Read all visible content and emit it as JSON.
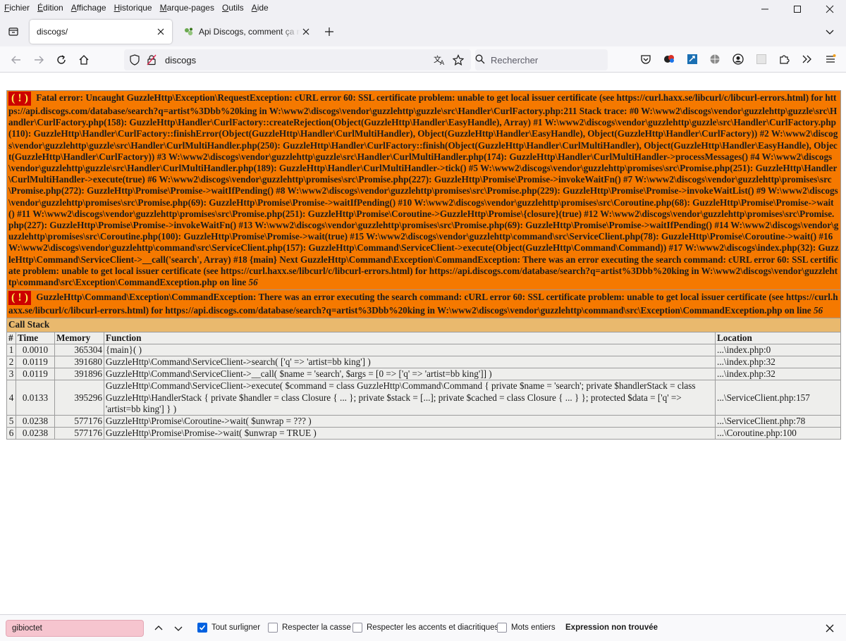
{
  "menubar": {
    "items": [
      {
        "underline": "F",
        "rest": "ichier"
      },
      {
        "underline": "É",
        "rest": "dition"
      },
      {
        "underline": "A",
        "rest": "ffichage"
      },
      {
        "underline": "H",
        "rest": "istorique"
      },
      {
        "underline": "M",
        "rest": "arque-pages"
      },
      {
        "underline": "O",
        "rest": "utils"
      },
      {
        "underline": "A",
        "rest": "ide"
      }
    ]
  },
  "tabs": {
    "active": {
      "title": "discogs/"
    },
    "inactive": {
      "title": "Api Discogs, comment ça marche"
    }
  },
  "navbar": {
    "url": "discogs",
    "search_placeholder": "Rechercher"
  },
  "error1": {
    "badge": "( ! )",
    "text": "Fatal error: Uncaught GuzzleHttp\\Exception\\RequestException: cURL error 60: SSL certificate problem: unable to get local issuer certificate (see https://curl.haxx.se/libcurl/c/libcurl-errors.html) for https://api.discogs.com/database/search?q=artist%3Dbb%20king in W:\\www2\\discogs\\vendor\\guzzlehttp\\guzzle\\src\\Handler\\CurlFactory.php:211 Stack trace: #0 W:\\www2\\discogs\\vendor\\guzzlehttp\\guzzle\\src\\Handler\\CurlFactory.php(158): GuzzleHttp\\Handler\\CurlFactory::createRejection(Object(GuzzleHttp\\Handler\\EasyHandle), Array) #1 W:\\www2\\discogs\\vendor\\guzzlehttp\\guzzle\\src\\Handler\\CurlFactory.php(110): GuzzleHttp\\Handler\\CurlFactory::finishError(Object(GuzzleHttp\\Handler\\CurlMultiHandler), Object(GuzzleHttp\\Handler\\EasyHandle), Object(GuzzleHttp\\Handler\\CurlFactory)) #2 W:\\www2\\discogs\\vendor\\guzzlehttp\\guzzle\\src\\Handler\\CurlMultiHandler.php(250): GuzzleHttp\\Handler\\CurlFactory::finish(Object(GuzzleHttp\\Handler\\CurlMultiHandler), Object(GuzzleHttp\\Handler\\EasyHandle), Object(GuzzleHttp\\Handler\\CurlFactory)) #3 W:\\www2\\discogs\\vendor\\guzzlehttp\\guzzle\\src\\Handler\\CurlMultiHandler.php(174): GuzzleHttp\\Handler\\CurlMultiHandler->processMessages() #4 W:\\www2\\discogs\\vendor\\guzzlehttp\\guzzle\\src\\Handler\\CurlMultiHandler.php(189): GuzzleHttp\\Handler\\CurlMultiHandler->tick() #5 W:\\www2\\discogs\\vendor\\guzzlehttp\\promises\\src\\Promise.php(251): GuzzleHttp\\Handler\\CurlMultiHandler->execute(true) #6 W:\\www2\\discogs\\vendor\\guzzlehttp\\promises\\src\\Promise.php(227): GuzzleHttp\\Promise\\Promise->invokeWaitFn() #7 W:\\www2\\discogs\\vendor\\guzzlehttp\\promises\\src\\Promise.php(272): GuzzleHttp\\Promise\\Promise->waitIfPending() #8 W:\\www2\\discogs\\vendor\\guzzlehttp\\promises\\src\\Promise.php(229): GuzzleHttp\\Promise\\Promise->invokeWaitList() #9 W:\\www2\\discogs\\vendor\\guzzlehttp\\promises\\src\\Promise.php(69): GuzzleHttp\\Promise\\Promise->waitIfPending() #10 W:\\www2\\discogs\\vendor\\guzzlehttp\\promises\\src\\Coroutine.php(68): GuzzleHttp\\Promise\\Promise->wait() #11 W:\\www2\\discogs\\vendor\\guzzlehttp\\promises\\src\\Promise.php(251): GuzzleHttp\\Promise\\Coroutine->GuzzleHttp\\Promise\\{closure}(true) #12 W:\\www2\\discogs\\vendor\\guzzlehttp\\promises\\src\\Promise.php(227): GuzzleHttp\\Promise\\Promise->invokeWaitFn() #13 W:\\www2\\discogs\\vendor\\guzzlehttp\\promises\\src\\Promise.php(69): GuzzleHttp\\Promise\\Promise->waitIfPending() #14 W:\\www2\\discogs\\vendor\\guzzlehttp\\promises\\src\\Coroutine.php(100): GuzzleHttp\\Promise\\Promise->wait(true) #15 W:\\www2\\discogs\\vendor\\guzzlehttp\\command\\src\\ServiceClient.php(78): GuzzleHttp\\Promise\\Coroutine->wait() #16 W:\\www2\\discogs\\vendor\\guzzlehttp\\command\\src\\ServiceClient.php(157): GuzzleHttp\\Command\\ServiceClient->execute(Object(GuzzleHttp\\Command\\Command)) #17 W:\\www2\\discogs\\index.php(32): GuzzleHttp\\Command\\ServiceClient->__call('search', Array) #18 {main} Next GuzzleHttp\\Command\\Exception\\CommandException: There was an error executing the search command: cURL error 60: SSL certificate problem: unable to get local issuer certificate (see https://curl.haxx.se/libcurl/c/libcurl-errors.html) for https://api.discogs.com/database/search?q=artist%3Dbb%20king in W:\\www2\\discogs\\vendor\\guzzlehttp\\command\\src\\Exception\\CommandException.php on line",
    "line": "56"
  },
  "error2": {
    "badge": "( ! )",
    "text": "GuzzleHttp\\Command\\Exception\\CommandException: There was an error executing the search command: cURL error 60: SSL certificate problem: unable to get local issuer certificate (see https://curl.haxx.se/libcurl/c/libcurl-errors.html) for https://api.discogs.com/database/search?q=artist%3Dbb%20king in W:\\www2\\discogs\\vendor\\guzzlehttp\\command\\src\\Exception\\CommandException.php on line",
    "line": "56"
  },
  "callstack": {
    "title": "Call Stack",
    "headers": {
      "num": "#",
      "time": "Time",
      "memory": "Memory",
      "function": "Function",
      "location": "Location"
    },
    "rows": [
      {
        "num": "1",
        "time": "0.0010",
        "memory": "365304",
        "function": "{main}( )",
        "location": "...\\index.php:0"
      },
      {
        "num": "2",
        "time": "0.0119",
        "memory": "391680",
        "function": "GuzzleHttp\\Command\\ServiceClient->search( ['q' => 'artist=bb king'] )",
        "location": "...\\index.php:32"
      },
      {
        "num": "3",
        "time": "0.0119",
        "memory": "391896",
        "function": "GuzzleHttp\\Command\\ServiceClient->__call( $name = 'search', $args = [0 => ['q' => 'artist=bb king']] )",
        "location": "...\\index.php:32"
      },
      {
        "num": "4",
        "time": "0.0133",
        "memory": "395296",
        "function": "GuzzleHttp\\Command\\ServiceClient->execute( $command = class GuzzleHttp\\Command\\Command { private $name = 'search'; private $handlerStack = class GuzzleHttp\\HandlerStack { private $handler = class Closure { ... }; private $stack = [...]; private $cached = class Closure { ... } }; protected $data = ['q' => 'artist=bb king'] } )",
        "location": "...\\ServiceClient.php:157"
      },
      {
        "num": "5",
        "time": "0.0238",
        "memory": "577176",
        "function": "GuzzleHttp\\Promise\\Coroutine->wait( $unwrap = ??? )",
        "location": "...\\ServiceClient.php:78"
      },
      {
        "num": "6",
        "time": "0.0238",
        "memory": "577176",
        "function": "GuzzleHttp\\Promise\\Promise->wait( $unwrap = TRUE )",
        "location": "...\\Coroutine.php:100"
      }
    ]
  },
  "findbar": {
    "value": "gibioctet",
    "opt_highlight": "Tout surligner",
    "opt_case": "Respecter la casse",
    "opt_accents": "Respecter les accents et diacritiques",
    "opt_words": "Mots entiers",
    "status": "Expression non trouvée",
    "highlight_checked": true
  },
  "colors": {
    "error_bg": "#f57900",
    "badge_bg": "#cc0000",
    "badge_fg": "#fce94f",
    "callstack_head": "#e9b96e",
    "row_bg": "#eeeeec",
    "find_input_bg": "#f6c5cf"
  }
}
